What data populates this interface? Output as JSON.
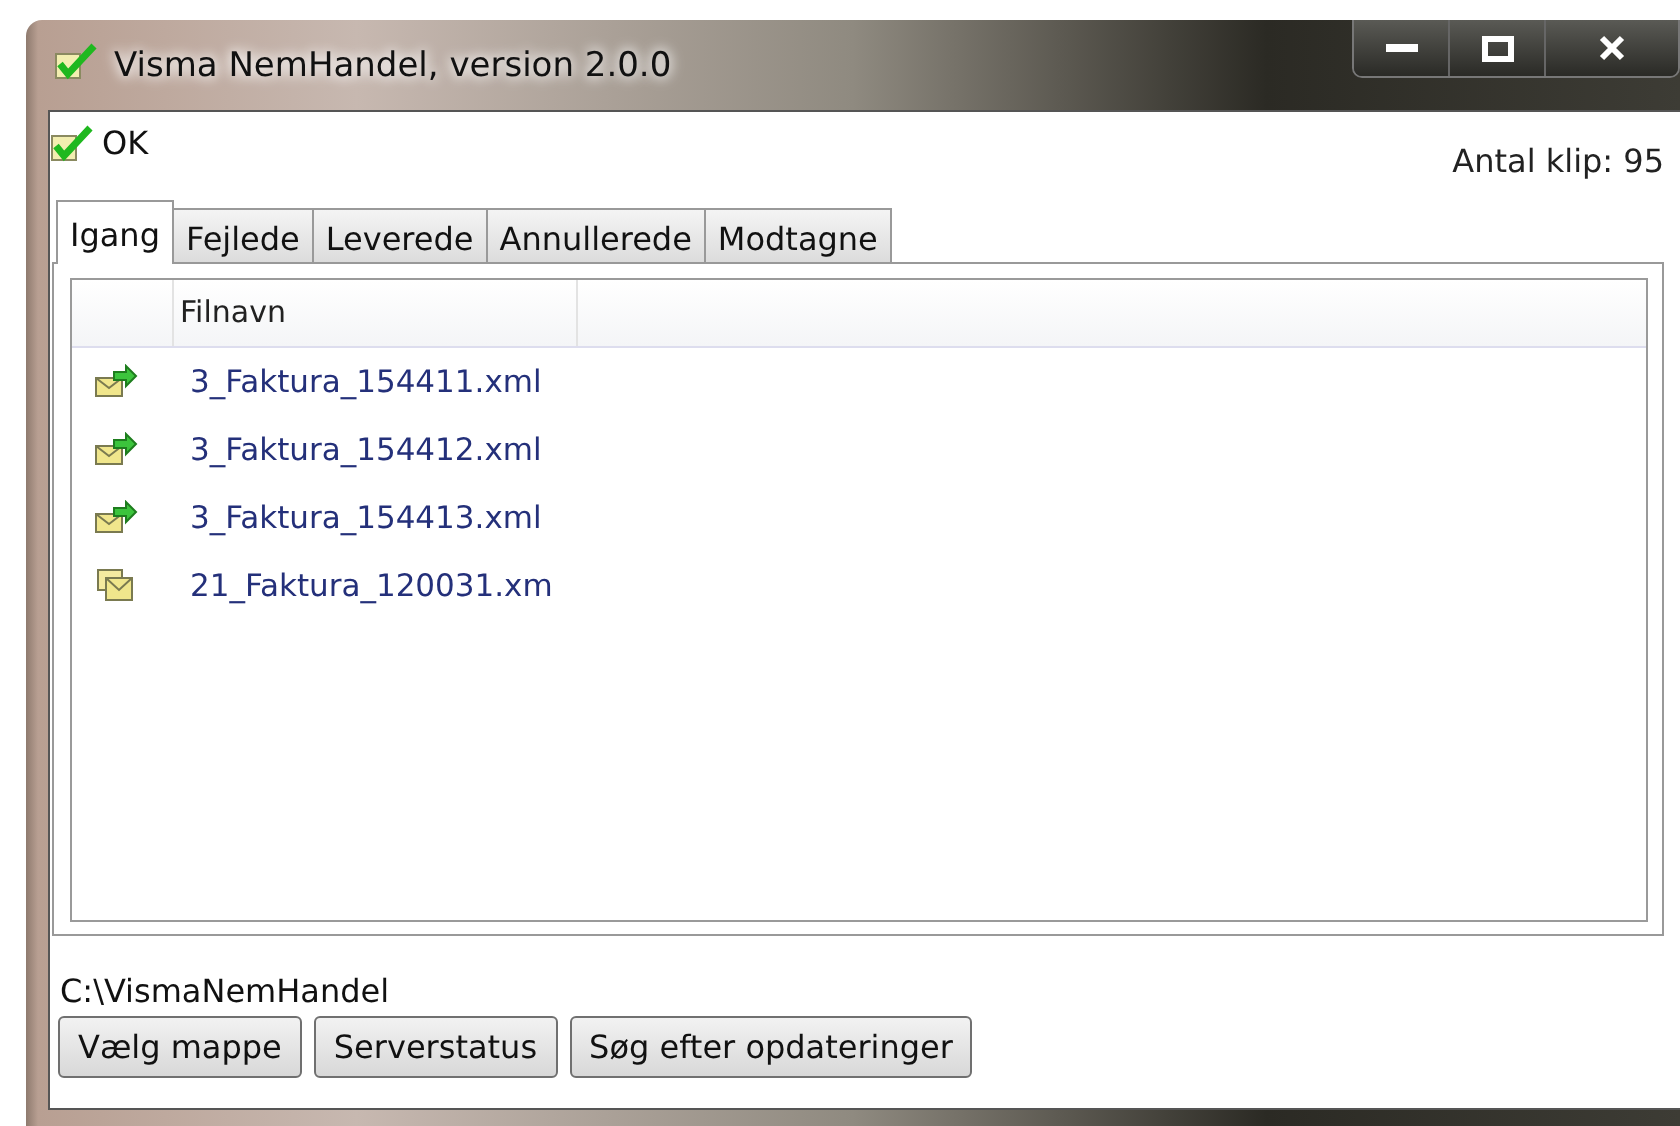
{
  "window": {
    "title": "Visma NemHandel, version 2.0.0"
  },
  "status": {
    "text": "OK",
    "counter": "Antal klip: 95"
  },
  "tabs": [
    {
      "label": "Igang",
      "selected": true
    },
    {
      "label": "Fejlede",
      "selected": false
    },
    {
      "label": "Leverede",
      "selected": false
    },
    {
      "label": "Annullerede",
      "selected": false
    },
    {
      "label": "Modtagne",
      "selected": false
    }
  ],
  "table": {
    "columns": [
      "Filnavn"
    ],
    "rows": [
      {
        "kind": "sent",
        "name": "3_Faktura_154411.xml"
      },
      {
        "kind": "sent",
        "name": "3_Faktura_154412.xml"
      },
      {
        "kind": "sent",
        "name": "3_Faktura_154413.xml"
      },
      {
        "kind": "pending",
        "name": "21_Faktura_120031.xm"
      }
    ]
  },
  "folder_path": "C:\\VismaNemHandel",
  "buttons": [
    "Vælg mappe",
    "Serverstatus",
    "Søg efter opdateringer"
  ]
}
